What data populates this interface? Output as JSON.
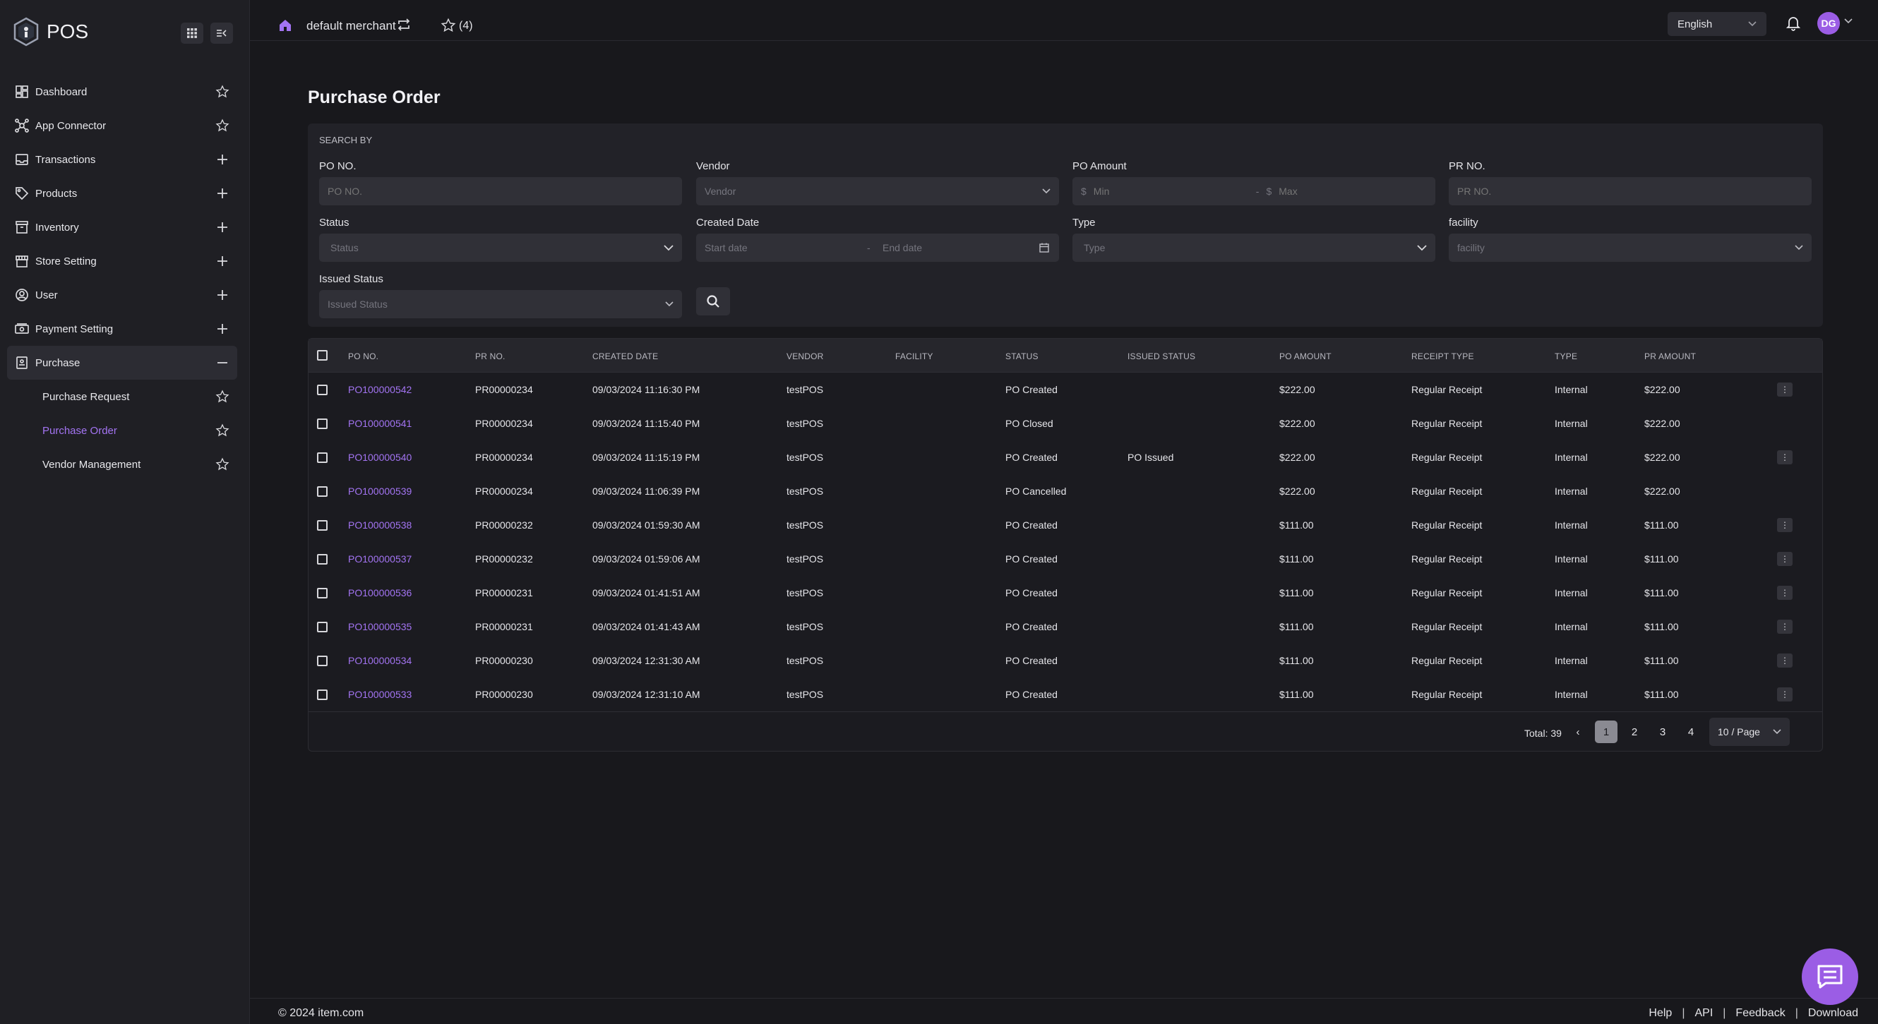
{
  "app": {
    "name": "POS"
  },
  "colors": {
    "accent": "#a374f2",
    "brand": "#9b5de5",
    "background": "#18181c",
    "sidebar": "#1f1f24"
  },
  "sidebar": {
    "items": [
      {
        "label": "Dashboard",
        "icon": "dashboard-icon",
        "action": "star"
      },
      {
        "label": "App Connector",
        "icon": "app-connector-icon",
        "action": "star"
      },
      {
        "label": "Transactions",
        "icon": "transactions-icon",
        "action": "plus"
      },
      {
        "label": "Products",
        "icon": "tag-icon",
        "action": "plus"
      },
      {
        "label": "Inventory",
        "icon": "inventory-icon",
        "action": "plus"
      },
      {
        "label": "Store Setting",
        "icon": "store-icon",
        "action": "plus"
      },
      {
        "label": "User",
        "icon": "user-icon",
        "action": "plus"
      },
      {
        "label": "Payment Setting",
        "icon": "payment-icon",
        "action": "plus"
      },
      {
        "label": "Purchase",
        "icon": "purchase-icon",
        "action": "minus"
      }
    ],
    "sub_items": [
      {
        "label": "Purchase Request"
      },
      {
        "label": "Purchase Order"
      },
      {
        "label": "Vendor Management"
      }
    ]
  },
  "header": {
    "merchant": "default merchant",
    "favorites_count": "(4)",
    "language": "English",
    "avatar_initials": "DG"
  },
  "page": {
    "title": "Purchase Order"
  },
  "search": {
    "heading": "SEARCH BY",
    "po_no": {
      "label": "PO NO.",
      "placeholder": "PO NO."
    },
    "vendor": {
      "label": "Vendor",
      "placeholder": "Vendor"
    },
    "po_amount": {
      "label": "PO Amount",
      "currency": "$",
      "min": "Min",
      "sep": "-",
      "max": "Max"
    },
    "pr_no": {
      "label": "PR NO.",
      "placeholder": "PR NO."
    },
    "status": {
      "label": "Status",
      "placeholder": "Status"
    },
    "created_date": {
      "label": "Created Date",
      "start": "Start date",
      "sep": "-",
      "end": "End date"
    },
    "type": {
      "label": "Type",
      "placeholder": "Type"
    },
    "facility": {
      "label": "facility",
      "placeholder": "facility"
    },
    "issued_status": {
      "label": "Issued Status",
      "placeholder": "Issued Status"
    }
  },
  "table": {
    "columns": [
      "PO NO.",
      "PR NO.",
      "CREATED DATE",
      "VENDOR",
      "FACILITY",
      "STATUS",
      "ISSUED STATUS",
      "PO AMOUNT",
      "RECEIPT TYPE",
      "TYPE",
      "PR AMOUNT"
    ],
    "rows": [
      {
        "po": "PO100000542",
        "pr": "PR00000234",
        "date": "09/03/2024 11:16:30 PM",
        "vendor": "testPOS",
        "facility": "",
        "status": "PO Created",
        "issued": "",
        "amount": "$222.00",
        "receipt": "Regular Receipt",
        "type": "Internal",
        "pr_amount": "$222.00",
        "more": "⋮"
      },
      {
        "po": "PO100000541",
        "pr": "PR00000234",
        "date": "09/03/2024 11:15:40 PM",
        "vendor": "testPOS",
        "facility": "",
        "status": "PO Closed",
        "issued": "",
        "amount": "$222.00",
        "receipt": "Regular Receipt",
        "type": "Internal",
        "pr_amount": "$222.00",
        "more": ""
      },
      {
        "po": "PO100000540",
        "pr": "PR00000234",
        "date": "09/03/2024 11:15:19 PM",
        "vendor": "testPOS",
        "facility": "",
        "status": "PO Created",
        "issued": "PO Issued",
        "amount": "$222.00",
        "receipt": "Regular Receipt",
        "type": "Internal",
        "pr_amount": "$222.00",
        "more": "⋮"
      },
      {
        "po": "PO100000539",
        "pr": "PR00000234",
        "date": "09/03/2024 11:06:39 PM",
        "vendor": "testPOS",
        "facility": "",
        "status": "PO Cancelled",
        "issued": "",
        "amount": "$222.00",
        "receipt": "Regular Receipt",
        "type": "Internal",
        "pr_amount": "$222.00",
        "more": ""
      },
      {
        "po": "PO100000538",
        "pr": "PR00000232",
        "date": "09/03/2024 01:59:30 AM",
        "vendor": "testPOS",
        "facility": "",
        "status": "PO Created",
        "issued": "",
        "amount": "$111.00",
        "receipt": "Regular Receipt",
        "type": "Internal",
        "pr_amount": "$111.00",
        "more": "⋮"
      },
      {
        "po": "PO100000537",
        "pr": "PR00000232",
        "date": "09/03/2024 01:59:06 AM",
        "vendor": "testPOS",
        "facility": "",
        "status": "PO Created",
        "issued": "",
        "amount": "$111.00",
        "receipt": "Regular Receipt",
        "type": "Internal",
        "pr_amount": "$111.00",
        "more": "⋮"
      },
      {
        "po": "PO100000536",
        "pr": "PR00000231",
        "date": "09/03/2024 01:41:51 AM",
        "vendor": "testPOS",
        "facility": "",
        "status": "PO Created",
        "issued": "",
        "amount": "$111.00",
        "receipt": "Regular Receipt",
        "type": "Internal",
        "pr_amount": "$111.00",
        "more": "⋮"
      },
      {
        "po": "PO100000535",
        "pr": "PR00000231",
        "date": "09/03/2024 01:41:43 AM",
        "vendor": "testPOS",
        "facility": "",
        "status": "PO Created",
        "issued": "",
        "amount": "$111.00",
        "receipt": "Regular Receipt",
        "type": "Internal",
        "pr_amount": "$111.00",
        "more": "⋮"
      },
      {
        "po": "PO100000534",
        "pr": "PR00000230",
        "date": "09/03/2024 12:31:30 AM",
        "vendor": "testPOS",
        "facility": "",
        "status": "PO Created",
        "issued": "",
        "amount": "$111.00",
        "receipt": "Regular Receipt",
        "type": "Internal",
        "pr_amount": "$111.00",
        "more": "⋮"
      },
      {
        "po": "PO100000533",
        "pr": "PR00000230",
        "date": "09/03/2024 12:31:10 AM",
        "vendor": "testPOS",
        "facility": "",
        "status": "PO Created",
        "issued": "",
        "amount": "$111.00",
        "receipt": "Regular Receipt",
        "type": "Internal",
        "pr_amount": "$111.00",
        "more": "⋮"
      }
    ]
  },
  "pagination": {
    "total": "Total: 39",
    "prev": "‹",
    "next": "›",
    "pages": [
      "1",
      "2",
      "3",
      "4"
    ],
    "current": "1",
    "per_page": "10 / Page"
  },
  "footer": {
    "copyright": "© 2024 item.com",
    "links": [
      "Help",
      "API",
      "Feedback",
      "Download"
    ],
    "sep": "|"
  }
}
